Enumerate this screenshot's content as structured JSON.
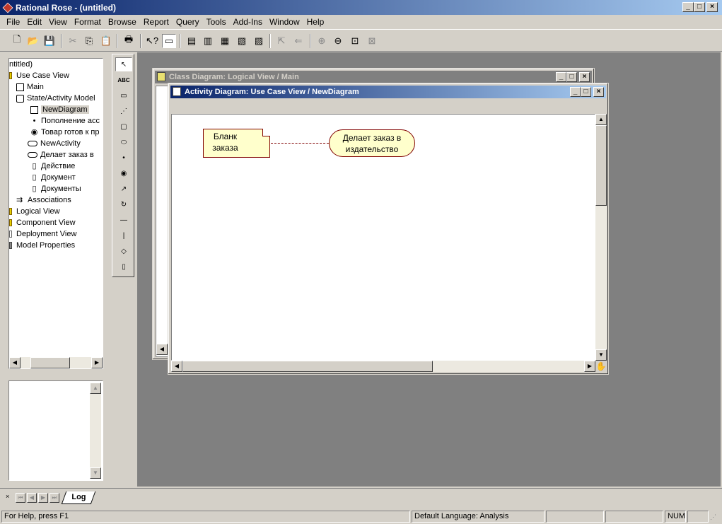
{
  "app": {
    "title": "Rational Rose - (untitled)"
  },
  "menu": [
    "File",
    "Edit",
    "View",
    "Format",
    "Browse",
    "Report",
    "Query",
    "Tools",
    "Add-Ins",
    "Window",
    "Help"
  ],
  "tree": {
    "root": "ntitled)",
    "use_case_view": "Use Case View",
    "main": "Main",
    "state_model": "State/Activity Model",
    "new_diagram": "NewDiagram",
    "item_popolnenie": "Пополнение асс",
    "item_tovar": "Товар готов к пр",
    "new_activity": "NewActivity",
    "item_delaet": "Делает заказ в",
    "item_deystvie": "Действие",
    "item_dokument": "Документ",
    "item_dokumenty": "Документы",
    "associations": "Associations",
    "logical_view": "Logical View",
    "component_view": "Component View",
    "deployment_view": "Deployment View",
    "model_properties": "Model Properties"
  },
  "windows": {
    "class_diagram": {
      "title": "Class Diagram: Logical View / Main"
    },
    "activity_diagram": {
      "title": "Activity Diagram: Use Case View / NewDiagram"
    }
  },
  "diagram": {
    "object_label": "Бланк заказа",
    "activity_label": "Делает заказ в издательство"
  },
  "tabs": {
    "log": "Log"
  },
  "status": {
    "help": "For Help, press F1",
    "language": "Default Language: Analysis",
    "num": "NUM"
  },
  "colors": {
    "title_active": "#0a246a",
    "title_inactive": "#808080",
    "diagram_object_border": "#800000",
    "diagram_object_fill": "#ffffcc"
  }
}
